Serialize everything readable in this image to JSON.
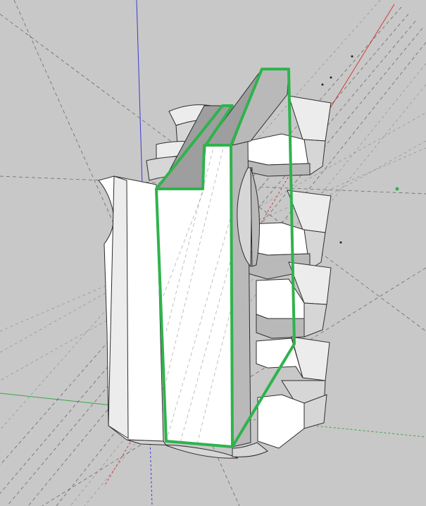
{
  "viewport": {
    "background": "#c8c8c8",
    "axis_colors": {
      "red": "#d23a3a",
      "green": "#3aa64a",
      "blue": "#3a3ad2"
    },
    "selection_color": "#2fb34d",
    "model_face_color": "#ffffff",
    "guide_line_color": "#3a3a3a"
  }
}
